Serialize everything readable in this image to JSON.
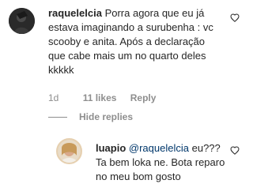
{
  "main_comment": {
    "username": "raquelelcia",
    "text": "Porra agora que eu já estava imaginando a surubenha : vc scooby e anita. Após a declaração que cabe mais um no quarto deles kkkkk",
    "time": "1d",
    "likes": "11 likes",
    "reply_label": "Reply",
    "hide_replies_label": "Hide replies"
  },
  "reply_comment": {
    "username": "luapio",
    "mention": "@raquelelcia",
    "text": "eu??? Ta bem loka ne. Bota reparo no meu bom gosto"
  },
  "colors": {
    "text": "#262626",
    "muted": "#8e8e8e",
    "mention": "#00376b"
  },
  "icons": {
    "like": "heart-outline-icon"
  }
}
